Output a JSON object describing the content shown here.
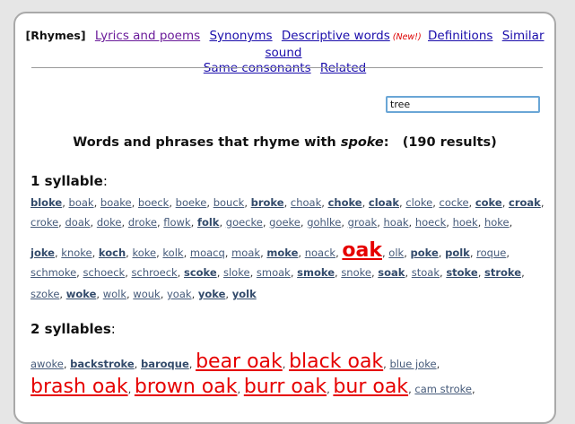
{
  "nav": {
    "current": "[Rhymes]",
    "links": [
      "Lyrics and poems",
      "Synonyms",
      "Descriptive words",
      "Definitions",
      "Similar sound",
      "Same consonants",
      "Related"
    ],
    "new_badge": "(New!)"
  },
  "search": {
    "value": "tree"
  },
  "heading": {
    "prefix": "Words and phrases that rhyme with ",
    "query": "spoke",
    "colon": ":",
    "count": "(190 results)"
  },
  "sections": [
    {
      "label_num": "1 syllable",
      "label_colon": ":"
    },
    {
      "label_num": "2 syllables",
      "label_colon": ":"
    }
  ],
  "one_syllable_lines": [
    [
      {
        "t": "bloke",
        "s": "b"
      },
      {
        "t": "boak"
      },
      {
        "t": "boake"
      },
      {
        "t": "boeck"
      },
      {
        "t": "boeke"
      },
      {
        "t": "bouck"
      },
      {
        "t": "broke",
        "s": "b"
      },
      {
        "t": "choak"
      },
      {
        "t": "choke",
        "s": "b"
      },
      {
        "t": "cloak",
        "s": "b"
      },
      {
        "t": "cloke"
      },
      {
        "t": "cocke"
      },
      {
        "t": "coke",
        "s": "b"
      },
      {
        "t": "croak",
        "s": "b"
      }
    ],
    [
      {
        "t": "croke"
      },
      {
        "t": "doak"
      },
      {
        "t": "doke"
      },
      {
        "t": "droke"
      },
      {
        "t": "flowk"
      },
      {
        "t": "folk",
        "s": "b"
      },
      {
        "t": "goecke"
      },
      {
        "t": "goeke"
      },
      {
        "t": "gohlke"
      },
      {
        "t": "groak"
      },
      {
        "t": "hoak"
      },
      {
        "t": "hoeck"
      },
      {
        "t": "hoek"
      },
      {
        "t": "hoke"
      }
    ],
    [
      {
        "t": "joke",
        "s": "b"
      },
      {
        "t": "knoke"
      },
      {
        "t": "koch",
        "s": "b"
      },
      {
        "t": "koke"
      },
      {
        "t": "kolk"
      },
      {
        "t": "moacq"
      },
      {
        "t": "moak"
      },
      {
        "t": "moke",
        "s": "b"
      },
      {
        "t": "noack"
      },
      {
        "t": "oak",
        "s": "bigb"
      },
      {
        "t": "olk"
      },
      {
        "t": "poke",
        "s": "b"
      },
      {
        "t": "polk",
        "s": "b"
      },
      {
        "t": "roque"
      }
    ],
    [
      {
        "t": "schmoke"
      },
      {
        "t": "schoeck"
      },
      {
        "t": "schroeck"
      },
      {
        "t": "scoke",
        "s": "b"
      },
      {
        "t": "sloke"
      },
      {
        "t": "smoak"
      },
      {
        "t": "smoke",
        "s": "b"
      },
      {
        "t": "snoke"
      },
      {
        "t": "soak",
        "s": "b"
      },
      {
        "t": "stoak"
      },
      {
        "t": "stoke",
        "s": "b"
      },
      {
        "t": "stroke",
        "s": "b"
      }
    ],
    [
      {
        "t": "szoke"
      },
      {
        "t": "woke",
        "s": "b"
      },
      {
        "t": "wolk"
      },
      {
        "t": "wouk"
      },
      {
        "t": "yoak"
      },
      {
        "t": "yoke",
        "s": "b"
      },
      {
        "t": "yolk",
        "s": "b",
        "last": true
      }
    ]
  ],
  "two_syllable_lines": [
    [
      {
        "t": "awoke"
      },
      {
        "t": "backstroke",
        "s": "b"
      },
      {
        "t": "baroque",
        "s": "b"
      },
      {
        "t": "bear oak",
        "s": "big"
      },
      {
        "t": "black oak",
        "s": "big"
      },
      {
        "t": "blue joke"
      }
    ],
    [
      {
        "t": "brash oak",
        "s": "big"
      },
      {
        "t": "brown oak",
        "s": "big"
      },
      {
        "t": "burr oak",
        "s": "big"
      },
      {
        "t": "bur oak",
        "s": "big"
      },
      {
        "t": "cam stroke"
      }
    ]
  ]
}
